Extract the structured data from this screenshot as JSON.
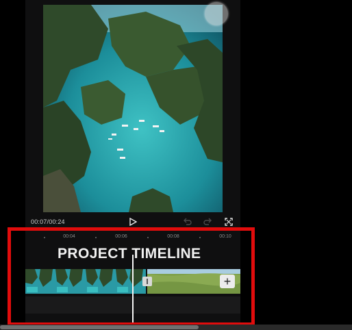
{
  "player": {
    "time_current": "00:07",
    "time_total": "00:24",
    "time_separator": "/",
    "icons": [
      "play-icon",
      "undo-icon",
      "redo-icon",
      "fullscreen-icon"
    ]
  },
  "timeline": {
    "title": "PROJECT TIMELINE",
    "ruler_ticks": [
      "00:04",
      "00:06",
      "00:08",
      "00:10"
    ],
    "add_clip_label": "+",
    "transition_icon": "transition-icon"
  },
  "colors": {
    "highlight": "#e10c0c",
    "background": "#000000",
    "panel": "#0f0f10"
  }
}
